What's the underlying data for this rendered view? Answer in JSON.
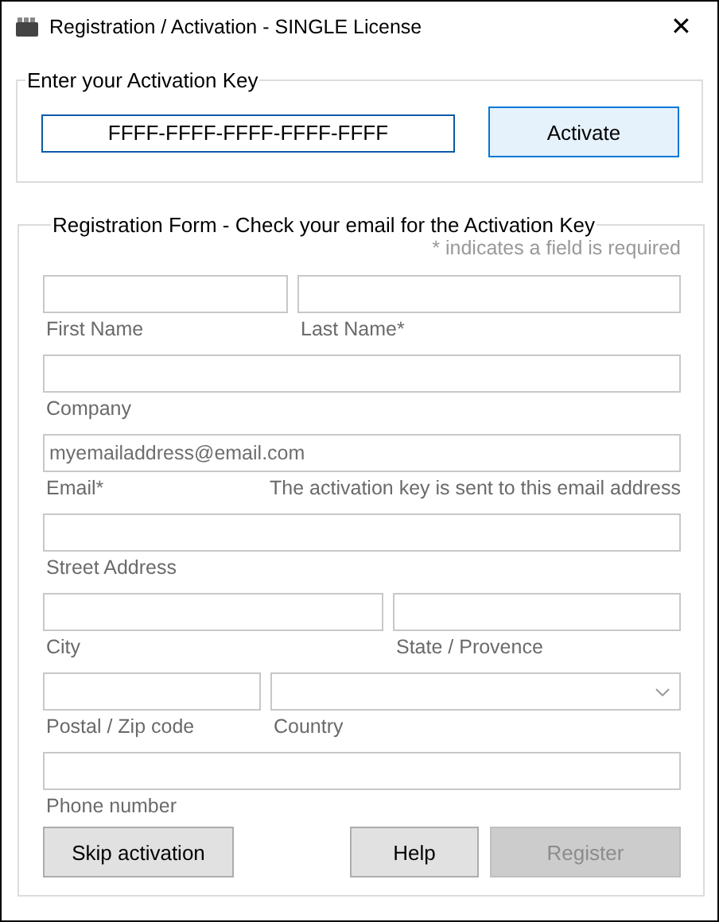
{
  "window": {
    "title": "Registration / Activation - SINGLE License",
    "close": "✕"
  },
  "activation": {
    "legend": "Enter your Activation Key",
    "key": "FFFF-FFFF-FFFF-FFFF-FFFF",
    "button": {
      "label": "Activate",
      "default": true
    }
  },
  "registration": {
    "legend": "Registration Form - Check your email for the Activation Key",
    "required_note": "* indicates a field is required",
    "rows": [
      {
        "fields": [
          {
            "kind": "text",
            "label": "First Name"
          },
          {
            "kind": "text",
            "label": "Last Name*"
          }
        ]
      },
      {
        "fields": [
          {
            "kind": "text",
            "label": "Company"
          }
        ]
      },
      {
        "fields": [
          {
            "kind": "text",
            "label": "Email*",
            "placeholder": "myemailaddress@email.com",
            "note": "The activation key is sent to this email address"
          }
        ]
      },
      {
        "fields": [
          {
            "kind": "text",
            "label": "Street Address"
          }
        ]
      },
      {
        "fields": [
          {
            "kind": "text",
            "label": "City"
          },
          {
            "kind": "text",
            "label": "State / Provence"
          }
        ]
      },
      {
        "fields": [
          {
            "kind": "text",
            "label": "Postal / Zip code"
          },
          {
            "kind": "select",
            "label": "Country"
          }
        ]
      },
      {
        "fields": [
          {
            "kind": "text",
            "label": "Phone number"
          }
        ]
      }
    ],
    "buttons": [
      {
        "label": "Skip activation",
        "disabled": false
      },
      {
        "label": "Help",
        "disabled": false
      },
      {
        "label": "Register",
        "disabled": true
      }
    ]
  }
}
